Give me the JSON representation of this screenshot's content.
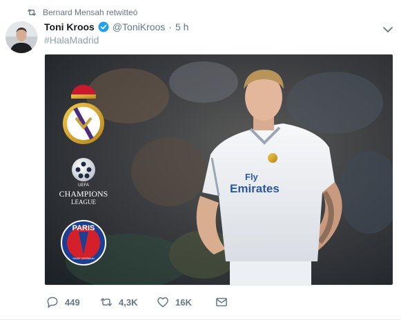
{
  "retweet_context": {
    "icon": "retweet-icon",
    "text": "Bernard Mensah retwitteó"
  },
  "author": {
    "name": "Toni Kroos",
    "verified": true,
    "handle": "@ToniKroos",
    "separator": "·",
    "time": "5 h"
  },
  "tweet_text": "#HalaMadrid",
  "media": {
    "jersey_text_line1": "Fly",
    "jersey_text_line2": "Emirates",
    "logos": {
      "ucl_line1": "CHAMPIONS",
      "ucl_line2": "LEAGUE",
      "uefa": "UEFA",
      "psg": "PARIS",
      "psg_sub": "SAINT-GERMAIN"
    }
  },
  "actions": {
    "reply_count": "449",
    "retweet_count": "4,3K",
    "like_count": "16K"
  },
  "colors": {
    "accent": "#1da1f2",
    "muted": "#657786",
    "hashtag": "#8da0b0",
    "madrid_gold": "#d9a629",
    "psg_blue": "#1c3f94",
    "psg_red": "#d4202a"
  }
}
